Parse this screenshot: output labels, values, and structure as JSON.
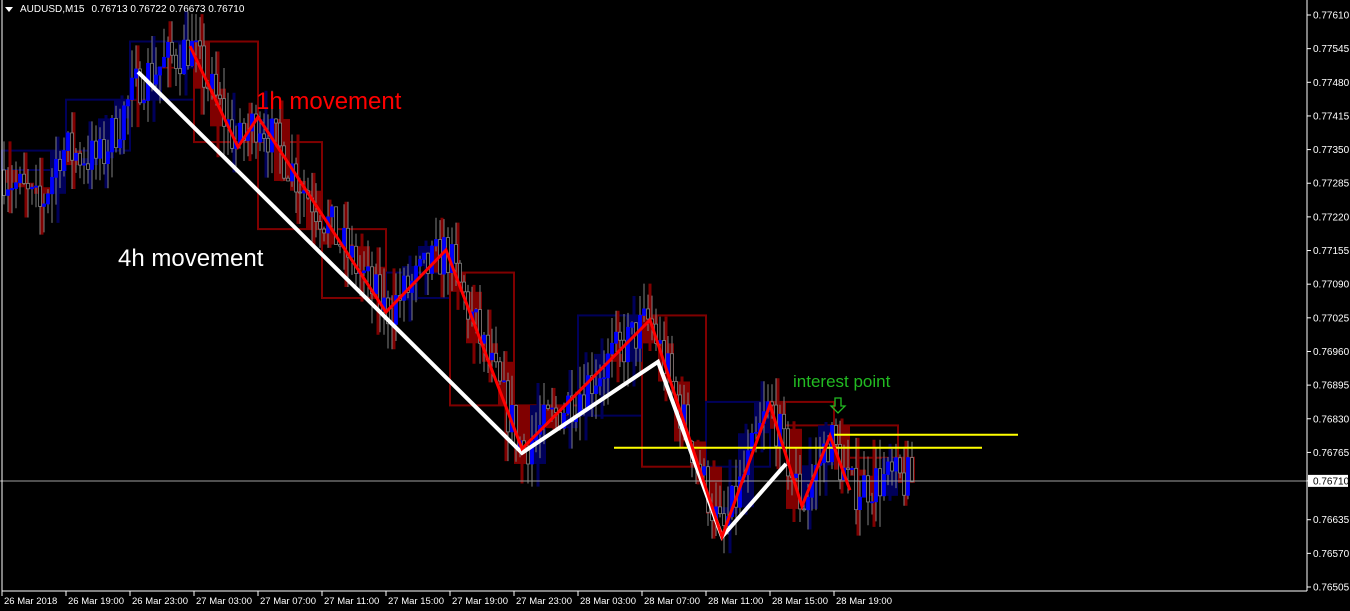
{
  "header": {
    "symbol": "AUDUSD,M15",
    "ohlc": "0.76713 0.76722 0.76673 0.76710"
  },
  "chart_data": {
    "type": "candlestick",
    "title": "AUDUSD,M15",
    "timeframe": "M15",
    "ylim": [
      0.76505,
      0.7761
    ],
    "xlim": [
      "2018-03-26 15:00",
      "2018-03-29 20:30"
    ],
    "y_ticks": [
      "0.77610",
      "0.77545",
      "0.77480",
      "0.77415",
      "0.77350",
      "0.77285",
      "0.77220",
      "0.77155",
      "0.77090",
      "0.77025",
      "0.76960",
      "0.76895",
      "0.76830",
      "0.76765",
      "0.76710",
      "0.76635",
      "0.76570",
      "0.76505"
    ],
    "x_ticks": [
      "26 Mar 2018",
      "26 Mar 19:00",
      "26 Mar 23:00",
      "27 Mar 03:00",
      "27 Mar 07:00",
      "27 Mar 11:00",
      "27 Mar 15:00",
      "27 Mar 19:00",
      "27 Mar 23:00",
      "28 Mar 03:00",
      "28 Mar 07:00",
      "28 Mar 11:00",
      "28 Mar 15:00",
      "28 Mar 19:00"
    ],
    "current_price": 0.7671,
    "grid": false,
    "colors": {
      "background": "#000000",
      "bull_body": "#0000ff",
      "bear_body": "#000000",
      "wick": "#808080",
      "h1_bull": "#00005a",
      "h1_bear": "#800000",
      "zigzag_4h": "#ffffff",
      "zigzag_1h": "#ff0000",
      "levels": "#ffff00",
      "annotation": "#22bb22",
      "price_line": "#a0a0a0"
    },
    "zigzag_4h": [
      {
        "t": "2018-03-26 23:30",
        "p": 0.775
      },
      {
        "t": "2018-03-27 23:30",
        "p": 0.76764
      },
      {
        "t": "2018-03-28 08:00",
        "p": 0.7694
      },
      {
        "t": "2018-03-28 12:00",
        "p": 0.76602
      },
      {
        "t": "2018-03-28 16:00",
        "p": 0.76743
      }
    ],
    "zigzag_1h": [
      {
        "t": "2018-03-27 02:45",
        "p": 0.7755
      },
      {
        "t": "2018-03-27 05:45",
        "p": 0.77355
      },
      {
        "t": "2018-03-27 07:00",
        "p": 0.77413
      },
      {
        "t": "2018-03-27 15:00",
        "p": 0.77036
      },
      {
        "t": "2018-03-27 18:45",
        "p": 0.77156
      },
      {
        "t": "2018-03-27 23:30",
        "p": 0.76772
      },
      {
        "t": "2018-03-28 07:30",
        "p": 0.77021
      },
      {
        "t": "2018-03-28 12:00",
        "p": 0.76602
      },
      {
        "t": "2018-03-28 15:00",
        "p": 0.76857
      },
      {
        "t": "2018-03-28 17:00",
        "p": 0.76661
      },
      {
        "t": "2018-03-28 18:45",
        "p": 0.76797
      },
      {
        "t": "2018-03-28 20:00",
        "p": 0.76692
      }
    ],
    "levels": [
      {
        "p": 0.76774,
        "from": "2018-03-28 05:15",
        "to": "2018-03-29 04:15"
      },
      {
        "p": 0.76799,
        "from": "2018-03-28 19:00",
        "to": "2018-03-29 06:30"
      }
    ],
    "annotations": {
      "label_1h": "1h movement",
      "label_4h": "4h movement",
      "interest_point": "interest point"
    }
  }
}
